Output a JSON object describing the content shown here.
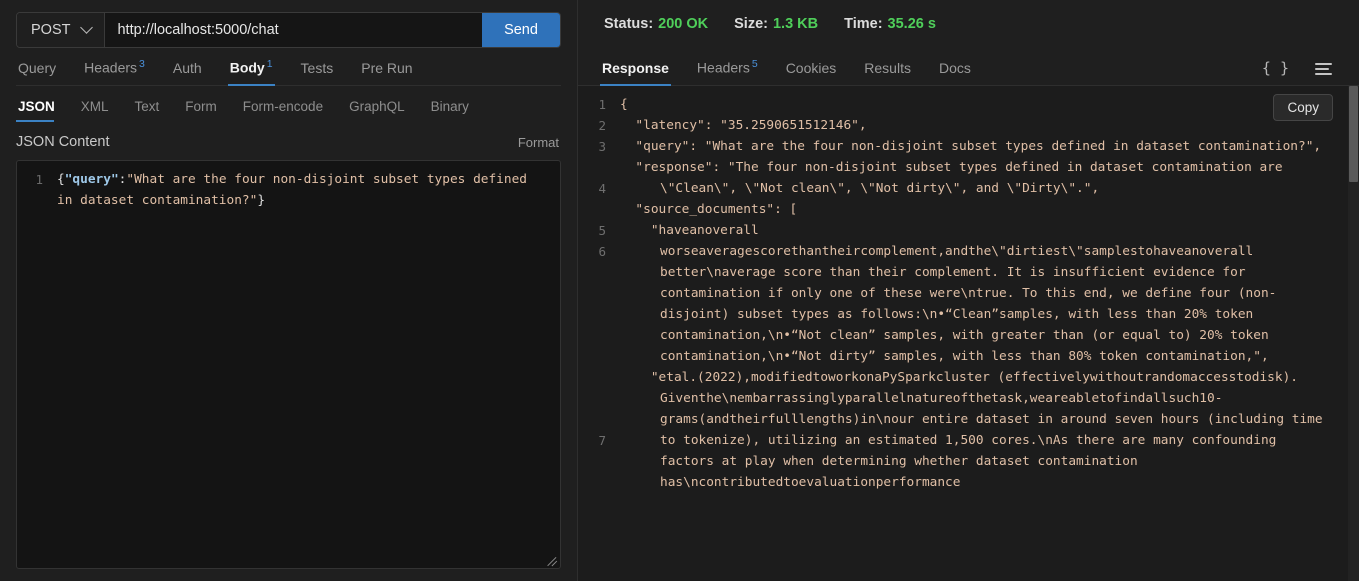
{
  "request": {
    "method": "POST",
    "url": "http://localhost:5000/chat",
    "send_label": "Send",
    "tabs": [
      {
        "label": "Query",
        "badge": "",
        "active": false
      },
      {
        "label": "Headers",
        "badge": "3",
        "active": false
      },
      {
        "label": "Auth",
        "badge": "",
        "active": false
      },
      {
        "label": "Body",
        "badge": "1",
        "active": true
      },
      {
        "label": "Tests",
        "badge": "",
        "active": false
      },
      {
        "label": "Pre Run",
        "badge": "",
        "active": false
      }
    ],
    "body_types": [
      {
        "label": "JSON",
        "active": true
      },
      {
        "label": "XML",
        "active": false
      },
      {
        "label": "Text",
        "active": false
      },
      {
        "label": "Form",
        "active": false
      },
      {
        "label": "Form-encode",
        "active": false
      },
      {
        "label": "GraphQL",
        "active": false
      },
      {
        "label": "Binary",
        "active": false
      }
    ],
    "content_title": "JSON Content",
    "format_label": "Format",
    "editor": {
      "line_numbers": [
        "1"
      ],
      "open_brace": "{",
      "key": "\"query\"",
      "colon": ":",
      "value": "\"What are the four non-disjoint subset types defined in dataset contamination?\"",
      "close_brace": "}"
    }
  },
  "response": {
    "status_label": "Status:",
    "status_value": "200 OK",
    "size_label": "Size:",
    "size_value": "1.3 KB",
    "time_label": "Time:",
    "time_value": "35.26 s",
    "tabs": [
      {
        "label": "Response",
        "badge": "",
        "active": true
      },
      {
        "label": "Headers",
        "badge": "5",
        "active": false
      },
      {
        "label": "Cookies",
        "badge": "",
        "active": false
      },
      {
        "label": "Results",
        "badge": "",
        "active": false
      },
      {
        "label": "Docs",
        "badge": "",
        "active": false
      }
    ],
    "braces_icon_label": "{ }",
    "copy_label": "Copy",
    "line_numbers": [
      "1",
      "2",
      "3",
      "4",
      "5",
      "6",
      "7"
    ],
    "lines": [
      {
        "n": "1",
        "text": "{"
      },
      {
        "n": "2",
        "text": "  \"latency\": \"35.2590651512146\","
      },
      {
        "n": "3",
        "text": "  \"query\": \"What are the four non-disjoint subset types defined in dataset contamination?\","
      },
      {
        "n": "4",
        "text": "  \"response\": \"The four non-disjoint subset types defined in dataset contamination are \\\"Clean\\\", \\\"Not clean\\\", \\\"Not dirty\\\", and \\\"Dirty\\\".\","
      },
      {
        "n": "5",
        "text": "  \"source_documents\": ["
      },
      {
        "n": "6",
        "text": "    \"haveanoverall worseaveragescorethantheircomplement,andthe\\\"dirtiest\\\"samplestohaveanoverall better\\naverage score than their complement. It is insufficient evidence for contamination if only one of these were\\ntrue. To this end, we define four (non-disjoint) subset types as follows:\\n•“Clean”samples, with less than 20% token contamination,\\n•“Not clean” samples, with greater than (or equal to) 20% token contamination,\\n•“Not dirty” samples, with less than 80% token contamination,\","
      },
      {
        "n": "7",
        "text": "    \"etal.(2022),modifiedtoworkonaPySparkcluster (effectivelywithoutrandomaccesstodisk). Giventhe\\nembarrassinglyparallelnatureofthetask,weareabletofindallsuch10-grams(andtheirfulllengths)in\\nour entire dataset in around seven hours (including time to tokenize), utilizing an estimated 1,500 cores.\\nAs there are many confounding factors at play when determining whether dataset contamination has\\ncontributedtoevaluationperformance"
      }
    ]
  },
  "colors": {
    "accent": "#3b82c4",
    "send_button": "#2f72ba",
    "status_green": "#4fcf5a",
    "string": "#e0bfa6",
    "key": "#9ec8e8",
    "background": "#1f1f1f"
  }
}
